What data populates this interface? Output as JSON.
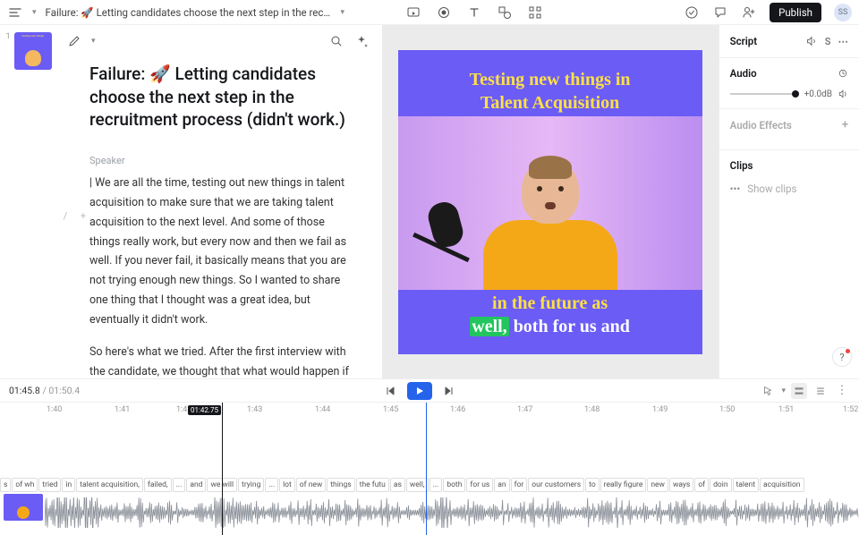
{
  "topbar": {
    "title": "Failure: 🚀 Letting candidates choose the next step in the recruitment process ...",
    "publish": "Publish",
    "avatar": "SS"
  },
  "script": {
    "doc_title": "Failure: 🚀 Letting candidates choose the next step in the recruitment process (didn't work.)",
    "speaker_label": "Speaker",
    "para1": "| We are all the time, testing out new things in talent acquisition to make sure that we are taking talent acquisition to the next level. And some of those things really work, but every now and then we fail as well. If you never fail, it basically means that you are not trying enough new things. So I wanted to share one thing that I thought was a great idea, but eventually it didn't work.",
    "para2": "So here's what we tried. After the first interview with the candidate, we thought that what would happen if we would give the candidate the opportunity to choose the"
  },
  "preview": {
    "line1": "Testing new things in",
    "line2": "Talent Acquisition",
    "cap_l1": "in the future as",
    "cap_hl": "well,",
    "cap_rest": " both for us and"
  },
  "panel": {
    "script": "Script",
    "audio": "Audio",
    "db": "+0.0dB",
    "effects": "Audio Effects",
    "clips": "Clips",
    "show_clips": "Show clips"
  },
  "transport": {
    "cur": "01:45.8",
    "dur": "01:50.4"
  },
  "ruler": {
    "ticks": [
      "1:40",
      "1:41",
      "1:42",
      "1:43",
      "1:44",
      "1:45",
      "1:46",
      "1:47",
      "1:48",
      "1:49",
      "1:50",
      "1:51",
      "1:52"
    ],
    "playhead": "01:42.75"
  },
  "words": [
    "s",
    "of wh",
    "tried",
    "in",
    "talent acquisition,",
    "failed,",
    "...",
    "and",
    "we will",
    "trying",
    "...",
    "lot",
    "of new",
    "things",
    "the futu",
    "as",
    "well,",
    "...",
    "both",
    "for us",
    "an",
    "for",
    "our customers",
    "to",
    "really figure",
    "new",
    "ways",
    "of",
    "doin",
    "talent",
    "acquisition"
  ]
}
